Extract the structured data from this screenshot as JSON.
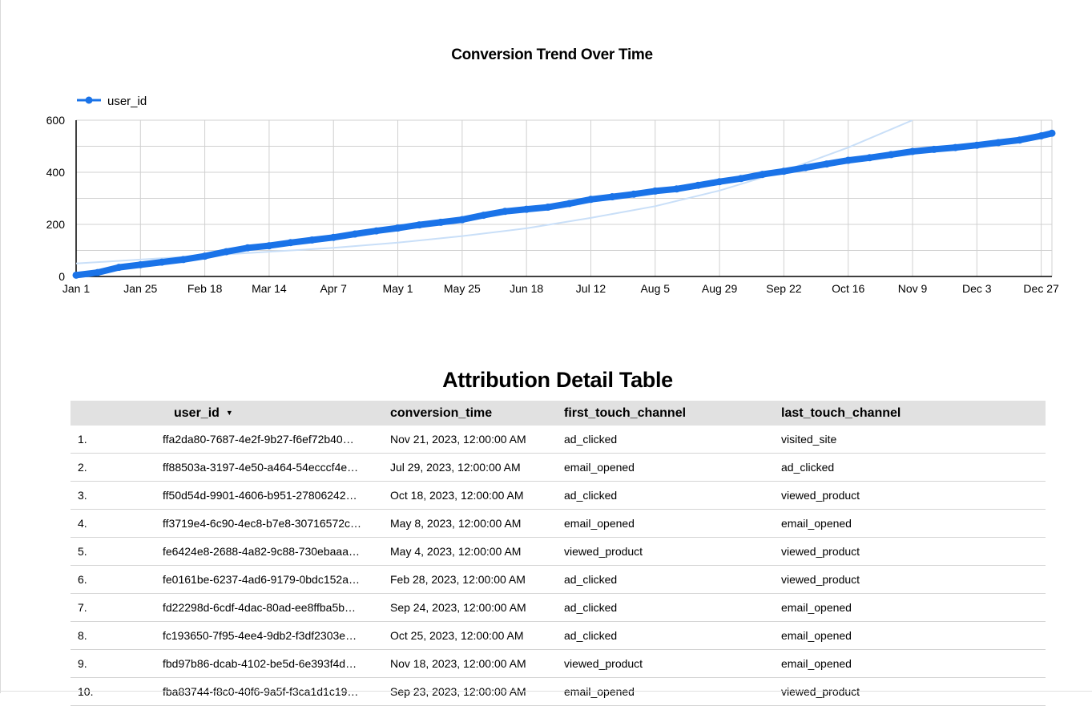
{
  "chart_data": {
    "type": "line",
    "title": "Conversion Trend Over Time",
    "xlabel": "",
    "ylabel": "",
    "legend": "top-left",
    "grid": true,
    "x_ticks": [
      "Jan 1",
      "Jan 25",
      "Feb 18",
      "Mar 14",
      "Apr 7",
      "May 1",
      "May 25",
      "Jun 18",
      "Jul 12",
      "Aug 5",
      "Aug 29",
      "Sep 22",
      "Oct 16",
      "Nov 9",
      "Dec 3",
      "Dec 27"
    ],
    "y_ticks": [
      "0",
      "200",
      "400",
      "600"
    ],
    "ylim": [
      0,
      600
    ],
    "xlim": [
      "2023-01-01",
      "2023-12-31"
    ],
    "series": [
      {
        "name": "user_id",
        "color": "#1a73e8",
        "x": [
          "2023-01-01",
          "2023-01-09",
          "2023-01-17",
          "2023-01-25",
          "2023-02-02",
          "2023-02-10",
          "2023-02-18",
          "2023-02-26",
          "2023-03-06",
          "2023-03-14",
          "2023-03-22",
          "2023-03-30",
          "2023-04-07",
          "2023-04-15",
          "2023-04-23",
          "2023-05-01",
          "2023-05-09",
          "2023-05-17",
          "2023-05-25",
          "2023-06-02",
          "2023-06-10",
          "2023-06-18",
          "2023-06-26",
          "2023-07-04",
          "2023-07-12",
          "2023-07-20",
          "2023-07-28",
          "2023-08-05",
          "2023-08-13",
          "2023-08-21",
          "2023-08-29",
          "2023-09-06",
          "2023-09-14",
          "2023-09-22",
          "2023-09-30",
          "2023-10-08",
          "2023-10-16",
          "2023-10-24",
          "2023-11-01",
          "2023-11-09",
          "2023-11-17",
          "2023-11-25",
          "2023-12-03",
          "2023-12-11",
          "2023-12-19",
          "2023-12-27",
          "2023-12-31"
        ],
        "values": [
          5,
          15,
          35,
          45,
          55,
          65,
          78,
          95,
          110,
          118,
          130,
          140,
          150,
          163,
          175,
          186,
          198,
          208,
          218,
          235,
          250,
          258,
          266,
          280,
          296,
          306,
          316,
          328,
          336,
          350,
          364,
          376,
          392,
          404,
          418,
          432,
          446,
          456,
          468,
          480,
          488,
          495,
          504,
          514,
          524,
          540,
          550
        ]
      },
      {
        "name": "",
        "color": "#c9dff8",
        "x": [
          "2023-01-01",
          "2023-01-25",
          "2023-02-18",
          "2023-03-14",
          "2023-04-07",
          "2023-05-01",
          "2023-05-25",
          "2023-06-18",
          "2023-07-12",
          "2023-08-05",
          "2023-08-29",
          "2023-09-22",
          "2023-10-16",
          "2023-11-09"
        ],
        "values": [
          50,
          65,
          80,
          95,
          110,
          130,
          155,
          185,
          225,
          270,
          330,
          405,
          495,
          600
        ]
      }
    ]
  },
  "table": {
    "title": "Attribution Detail Table",
    "headers": [
      "user_id",
      "conversion_time",
      "first_touch_channel",
      "last_touch_channel"
    ],
    "sort_icon": "sort-down-icon",
    "rows": [
      [
        "1.",
        "ffa2da80-7687-4e2f-9b27-f6ef72b40…",
        "Nov 21, 2023, 12:00:00 AM",
        "ad_clicked",
        "visited_site"
      ],
      [
        "2.",
        "ff88503a-3197-4e50-a464-54ecccf4e…",
        "Jul 29, 2023, 12:00:00 AM",
        "email_opened",
        "ad_clicked"
      ],
      [
        "3.",
        "ff50d54d-9901-4606-b951-27806242…",
        "Oct 18, 2023, 12:00:00 AM",
        "ad_clicked",
        "viewed_product"
      ],
      [
        "4.",
        "ff3719e4-6c90-4ec8-b7e8-30716572c…",
        "May 8, 2023, 12:00:00 AM",
        "email_opened",
        "email_opened"
      ],
      [
        "5.",
        "fe6424e8-2688-4a82-9c88-730ebaaa…",
        "May 4, 2023, 12:00:00 AM",
        "viewed_product",
        "viewed_product"
      ],
      [
        "6.",
        "fe0161be-6237-4ad6-9179-0bdc152a…",
        "Feb 28, 2023, 12:00:00 AM",
        "ad_clicked",
        "viewed_product"
      ],
      [
        "7.",
        "fd22298d-6cdf-4dac-80ad-ee8ffba5b…",
        "Sep 24, 2023, 12:00:00 AM",
        "ad_clicked",
        "email_opened"
      ],
      [
        "8.",
        "fc193650-7f95-4ee4-9db2-f3df2303e…",
        "Oct 25, 2023, 12:00:00 AM",
        "ad_clicked",
        "email_opened"
      ],
      [
        "9.",
        "fbd97b86-dcab-4102-be5d-6e393f4d…",
        "Nov 18, 2023, 12:00:00 AM",
        "viewed_product",
        "email_opened"
      ],
      [
        "10.",
        "fba83744-f8c0-40f6-9a5f-f3ca1d1c19…",
        "Sep 23, 2023, 12:00:00 AM",
        "email_opened",
        "viewed_product"
      ]
    ]
  }
}
